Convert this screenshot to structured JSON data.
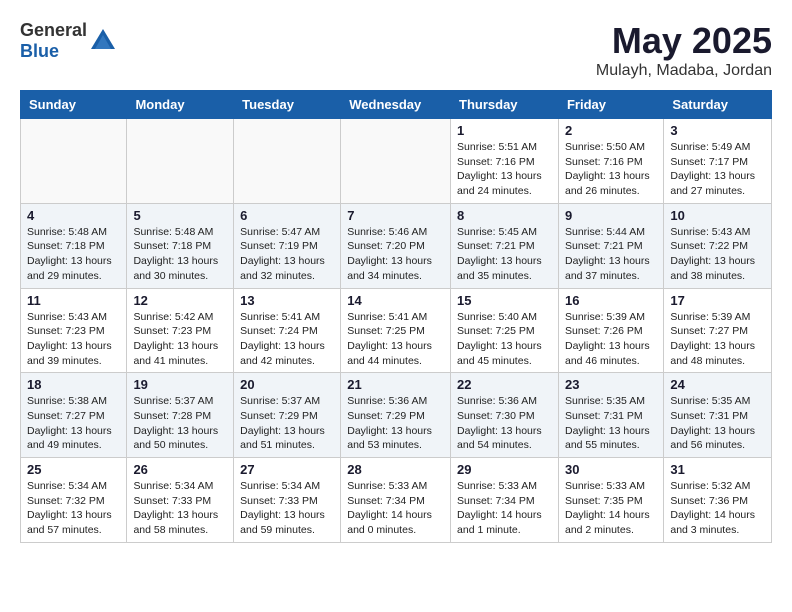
{
  "header": {
    "logo_general": "General",
    "logo_blue": "Blue",
    "month": "May 2025",
    "location": "Mulayh, Madaba, Jordan"
  },
  "weekdays": [
    "Sunday",
    "Monday",
    "Tuesday",
    "Wednesday",
    "Thursday",
    "Friday",
    "Saturday"
  ],
  "weeks": [
    [
      {
        "day": "",
        "info": ""
      },
      {
        "day": "",
        "info": ""
      },
      {
        "day": "",
        "info": ""
      },
      {
        "day": "",
        "info": ""
      },
      {
        "day": "1",
        "info": "Sunrise: 5:51 AM\nSunset: 7:16 PM\nDaylight: 13 hours\nand 24 minutes."
      },
      {
        "day": "2",
        "info": "Sunrise: 5:50 AM\nSunset: 7:16 PM\nDaylight: 13 hours\nand 26 minutes."
      },
      {
        "day": "3",
        "info": "Sunrise: 5:49 AM\nSunset: 7:17 PM\nDaylight: 13 hours\nand 27 minutes."
      }
    ],
    [
      {
        "day": "4",
        "info": "Sunrise: 5:48 AM\nSunset: 7:18 PM\nDaylight: 13 hours\nand 29 minutes."
      },
      {
        "day": "5",
        "info": "Sunrise: 5:48 AM\nSunset: 7:18 PM\nDaylight: 13 hours\nand 30 minutes."
      },
      {
        "day": "6",
        "info": "Sunrise: 5:47 AM\nSunset: 7:19 PM\nDaylight: 13 hours\nand 32 minutes."
      },
      {
        "day": "7",
        "info": "Sunrise: 5:46 AM\nSunset: 7:20 PM\nDaylight: 13 hours\nand 34 minutes."
      },
      {
        "day": "8",
        "info": "Sunrise: 5:45 AM\nSunset: 7:21 PM\nDaylight: 13 hours\nand 35 minutes."
      },
      {
        "day": "9",
        "info": "Sunrise: 5:44 AM\nSunset: 7:21 PM\nDaylight: 13 hours\nand 37 minutes."
      },
      {
        "day": "10",
        "info": "Sunrise: 5:43 AM\nSunset: 7:22 PM\nDaylight: 13 hours\nand 38 minutes."
      }
    ],
    [
      {
        "day": "11",
        "info": "Sunrise: 5:43 AM\nSunset: 7:23 PM\nDaylight: 13 hours\nand 39 minutes."
      },
      {
        "day": "12",
        "info": "Sunrise: 5:42 AM\nSunset: 7:23 PM\nDaylight: 13 hours\nand 41 minutes."
      },
      {
        "day": "13",
        "info": "Sunrise: 5:41 AM\nSunset: 7:24 PM\nDaylight: 13 hours\nand 42 minutes."
      },
      {
        "day": "14",
        "info": "Sunrise: 5:41 AM\nSunset: 7:25 PM\nDaylight: 13 hours\nand 44 minutes."
      },
      {
        "day": "15",
        "info": "Sunrise: 5:40 AM\nSunset: 7:25 PM\nDaylight: 13 hours\nand 45 minutes."
      },
      {
        "day": "16",
        "info": "Sunrise: 5:39 AM\nSunset: 7:26 PM\nDaylight: 13 hours\nand 46 minutes."
      },
      {
        "day": "17",
        "info": "Sunrise: 5:39 AM\nSunset: 7:27 PM\nDaylight: 13 hours\nand 48 minutes."
      }
    ],
    [
      {
        "day": "18",
        "info": "Sunrise: 5:38 AM\nSunset: 7:27 PM\nDaylight: 13 hours\nand 49 minutes."
      },
      {
        "day": "19",
        "info": "Sunrise: 5:37 AM\nSunset: 7:28 PM\nDaylight: 13 hours\nand 50 minutes."
      },
      {
        "day": "20",
        "info": "Sunrise: 5:37 AM\nSunset: 7:29 PM\nDaylight: 13 hours\nand 51 minutes."
      },
      {
        "day": "21",
        "info": "Sunrise: 5:36 AM\nSunset: 7:29 PM\nDaylight: 13 hours\nand 53 minutes."
      },
      {
        "day": "22",
        "info": "Sunrise: 5:36 AM\nSunset: 7:30 PM\nDaylight: 13 hours\nand 54 minutes."
      },
      {
        "day": "23",
        "info": "Sunrise: 5:35 AM\nSunset: 7:31 PM\nDaylight: 13 hours\nand 55 minutes."
      },
      {
        "day": "24",
        "info": "Sunrise: 5:35 AM\nSunset: 7:31 PM\nDaylight: 13 hours\nand 56 minutes."
      }
    ],
    [
      {
        "day": "25",
        "info": "Sunrise: 5:34 AM\nSunset: 7:32 PM\nDaylight: 13 hours\nand 57 minutes."
      },
      {
        "day": "26",
        "info": "Sunrise: 5:34 AM\nSunset: 7:33 PM\nDaylight: 13 hours\nand 58 minutes."
      },
      {
        "day": "27",
        "info": "Sunrise: 5:34 AM\nSunset: 7:33 PM\nDaylight: 13 hours\nand 59 minutes."
      },
      {
        "day": "28",
        "info": "Sunrise: 5:33 AM\nSunset: 7:34 PM\nDaylight: 14 hours\nand 0 minutes."
      },
      {
        "day": "29",
        "info": "Sunrise: 5:33 AM\nSunset: 7:34 PM\nDaylight: 14 hours\nand 1 minute."
      },
      {
        "day": "30",
        "info": "Sunrise: 5:33 AM\nSunset: 7:35 PM\nDaylight: 14 hours\nand 2 minutes."
      },
      {
        "day": "31",
        "info": "Sunrise: 5:32 AM\nSunset: 7:36 PM\nDaylight: 14 hours\nand 3 minutes."
      }
    ]
  ]
}
